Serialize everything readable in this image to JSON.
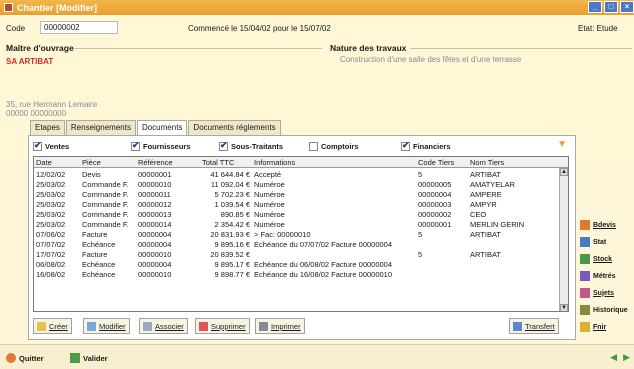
{
  "window": {
    "title": "Chantier [Modifier]",
    "buttons": [
      "_",
      "□",
      "×"
    ]
  },
  "header": {
    "code_label": "Code",
    "code_value": "00000002",
    "dates_text": "Commencé le 15/04/02 pour le 15/07/02",
    "state_text": "Etat: Etude"
  },
  "owner": {
    "title": "Maître d'ouvrage",
    "name": "SA ARTIBAT",
    "address1": "35, rue Hermann Lemaire",
    "address2": "00000 00000000"
  },
  "works": {
    "title": "Nature des travaux",
    "desc": "Construction d'une salle des fêtes et d'une terrasse"
  },
  "tabs": [
    "Etapes",
    "Renseignements",
    "Documents",
    "Documents réglements"
  ],
  "filters": [
    {
      "label": "Ventes",
      "checked": true
    },
    {
      "label": "Fournisseurs",
      "checked": true
    },
    {
      "label": "Sous-Traitants",
      "checked": true
    },
    {
      "label": "Comptoirs",
      "checked": false
    },
    {
      "label": "Financiers",
      "checked": true
    }
  ],
  "table": {
    "headers": [
      "Date",
      "Pièce",
      "Référence",
      "Total TTC",
      "Informations",
      "Code Tiers",
      "Nom Tiers"
    ],
    "rows": [
      [
        "12/02/02",
        "Devis",
        "00000001",
        "41 644.84 €",
        "Accepté",
        "5",
        "ARTIBAT"
      ],
      [
        "25/03/02",
        "Commande F.",
        "00000010",
        "11 092.04 €",
        "Numéroe",
        "00000005",
        "AMATYELAR"
      ],
      [
        "25/03/02",
        "Commande F.",
        "00000011",
        "5 702.23 €",
        "Numéroe",
        "00000004",
        "AMPERE"
      ],
      [
        "25/03/02",
        "Commande F.",
        "00000012",
        "1 039.54 €",
        "Numéroe",
        "00000003",
        "AMPYR"
      ],
      [
        "25/03/02",
        "Commande F.",
        "00000013",
        "890.85 €",
        "Numéroe",
        "00000002",
        "CEO"
      ],
      [
        "25/03/02",
        "Commande F.",
        "00000014",
        "2 354.42 €",
        "Numéroe",
        "00000001",
        "MERLIN GERIN"
      ],
      [
        "07/06/02",
        "Facture",
        "00000004",
        "20 831.93 €",
        "> Fac: 00000010",
        "5",
        "ARTIBAT"
      ],
      [
        "07/07/02",
        "Echéance",
        "00000004",
        "9 895.16 €",
        "Echéance du 07/07/02 Facture 00000004",
        "",
        ""
      ],
      [
        "17/07/02",
        "Facture",
        "00000010",
        "20 839.52 €",
        "",
        "5",
        "ARTIBAT"
      ],
      [
        "06/08/02",
        "Echéance",
        "00000004",
        "9 895.17 €",
        "Echéance du 06/08/02 Facture 00000004",
        "",
        ""
      ],
      [
        "16/08/02",
        "Echéance",
        "00000010",
        "9 898.77 €",
        "Echéance du 16/08/02 Facture 00000010",
        "",
        ""
      ]
    ]
  },
  "actions": [
    "Créer",
    "Modifier",
    "Associer",
    "Supprimer",
    "Imprimer",
    "Transfert"
  ],
  "side_buttons": [
    "Bdevis",
    "Stat",
    "Stock",
    "Métrés",
    "Sujets",
    "Historique",
    "Fnir"
  ],
  "footer": {
    "quit": "Quitter",
    "validate": "Valider"
  },
  "colors": {
    "title_bar": "#e8a030",
    "accent": "#d02a2a",
    "background": "#fdf6d8"
  }
}
